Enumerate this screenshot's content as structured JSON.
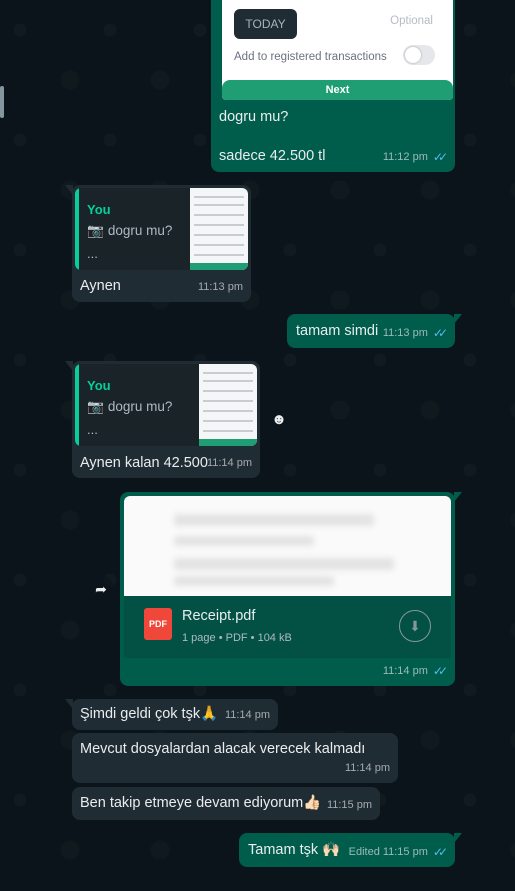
{
  "top_message": {
    "image": {
      "date_pill": "TODAY",
      "optional": "Optional",
      "registered_label": "Add to registered transactions",
      "next_button": "Next"
    },
    "caption_line1": "dogru mu?",
    "caption_line2": "sadece 42.500 tl",
    "time": "11:12 pm"
  },
  "reply1": {
    "quote_author": "You",
    "quote_text": "dogru mu?",
    "quote_more": "...",
    "text": "Aynen",
    "time": "11:13 pm"
  },
  "msg_tamam": {
    "text": "tamam simdi",
    "time": "11:13 pm"
  },
  "reply2": {
    "quote_author": "You",
    "quote_text": "dogru mu?",
    "quote_more": "...",
    "text": "Aynen kalan 42.500",
    "time": "11:14 pm"
  },
  "pdf_message": {
    "file_name": "Receipt.pdf",
    "meta": "1 page • PDF • 104 kB",
    "icon_label": "PDF",
    "time": "11:14 pm"
  },
  "in_msgs": [
    {
      "text": "Şimdi geldi çok tşk🙏",
      "time": "11:14 pm"
    },
    {
      "text": "Mevcut dosyalardan alacak verecek kalmadı",
      "time": "11:14 pm"
    },
    {
      "text": "Ben takip etmeye devam ediyorum👍🏻",
      "time": "11:15 pm"
    }
  ],
  "last_msg": {
    "text": "Tamam tşk 🙌🏻",
    "edited": "Edited",
    "time": "11:15 pm"
  },
  "icons": {
    "read_ticks": "double-check-icon",
    "camera": "camera-icon",
    "forward": "forward-icon",
    "download": "download-icon",
    "react": "smiley-icon"
  },
  "colors": {
    "outgoing": "#005c4b",
    "incoming": "#202c33",
    "accent": "#06cf9c",
    "ticks": "#53bdeb"
  }
}
